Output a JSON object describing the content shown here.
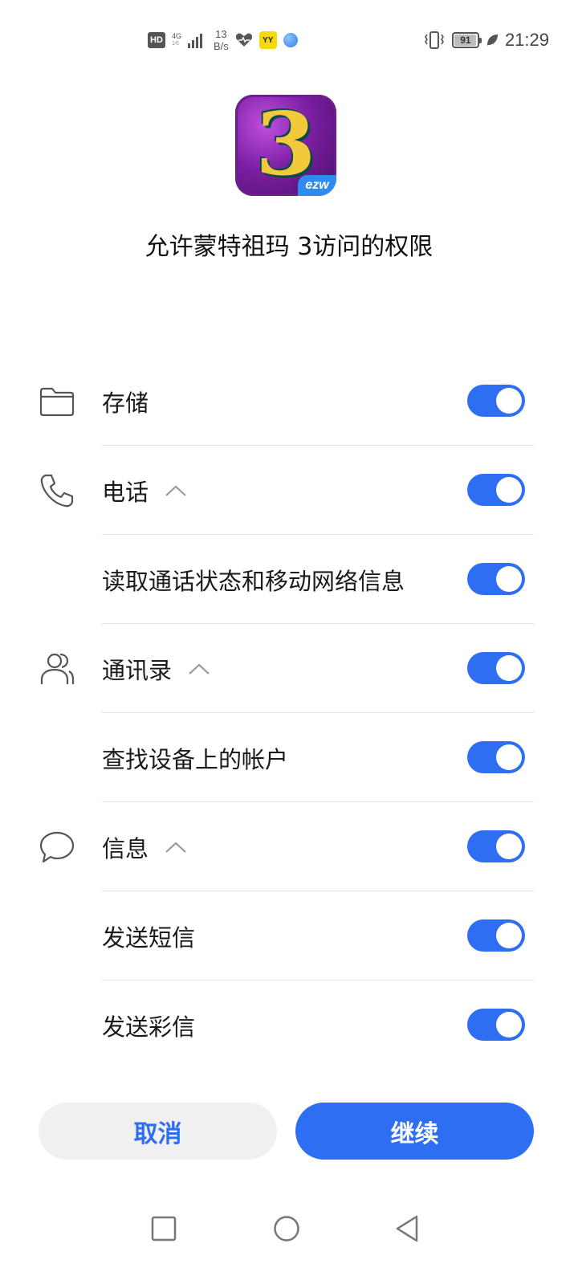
{
  "status_bar": {
    "hd_label": "HD",
    "network_type": "4G",
    "network_sub": "1⁄6",
    "speed_value": "13",
    "speed_unit": "B/s",
    "yy_label": "YY",
    "battery": "91",
    "battery_level": 0.91,
    "time": "21:29",
    "icons": [
      "hd-icon",
      "signal-icon",
      "health-icon",
      "yy-app-icon",
      "globe-icon",
      "vibrate-icon",
      "battery-icon",
      "leaf-icon"
    ]
  },
  "app": {
    "icon_numeral": "3",
    "icon_tag": "ezw",
    "title": "允许蒙特祖玛 3访问的权限"
  },
  "permissions": [
    {
      "label": "存储",
      "icon": "folder-icon",
      "expandable": false,
      "enabled": true
    },
    {
      "label": "电话",
      "icon": "phone-icon",
      "expandable": true,
      "enabled": true
    },
    {
      "label": "读取通话状态和移动网络信息",
      "icon": "",
      "expandable": false,
      "enabled": true
    },
    {
      "label": "通讯录",
      "icon": "contacts-icon",
      "expandable": true,
      "enabled": true
    },
    {
      "label": "查找设备上的帐户",
      "icon": "",
      "expandable": false,
      "enabled": true
    },
    {
      "label": "信息",
      "icon": "message-icon",
      "expandable": true,
      "enabled": true
    },
    {
      "label": "发送短信",
      "icon": "",
      "expandable": false,
      "enabled": true
    },
    {
      "label": "发送彩信",
      "icon": "",
      "expandable": false,
      "enabled": true
    }
  ],
  "buttons": {
    "cancel": "取消",
    "continue": "继续"
  },
  "colors": {
    "accent": "#2d6ef2",
    "cancel_bg": "#f0f0f0"
  },
  "navbar": {
    "icons": [
      "recents-square-icon",
      "home-circle-icon",
      "back-triangle-icon"
    ]
  }
}
